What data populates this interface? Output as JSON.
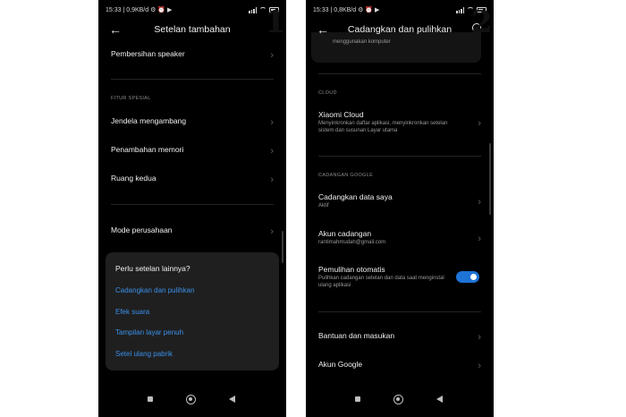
{
  "screen1": {
    "status": {
      "time_info": "15:33 | 0,9KB/d ⚙ ⏰ ▶",
      "battery": "84"
    },
    "title": "Setelan tambahan",
    "items_top": [
      {
        "label": "Pembersihan speaker"
      }
    ],
    "section_label": "FITUR SPESIAL",
    "items_special": [
      {
        "label": "Jendela mengambang"
      },
      {
        "label": "Penambahan memori"
      },
      {
        "label": "Ruang kedua"
      }
    ],
    "items_enterprise": [
      {
        "label": "Mode perusahaan"
      }
    ],
    "card": {
      "title": "Perlu setelan lainnya?",
      "links": [
        "Cadangkan dan pulihkan",
        "Efek suara",
        "Tampilan layar penuh",
        "Setel ulang pabrik"
      ]
    },
    "number_label": "1"
  },
  "screen2": {
    "status": {
      "time_info": "15:33 | 0,8KB/d ⚙ ⏰ ▶",
      "battery": "84"
    },
    "title": "Cadangkan dan pulihkan",
    "partial_text": "menggunakan komputer",
    "cloud_section": "CLOUD",
    "xiaomi_cloud": {
      "label": "Xiaomi Cloud",
      "sub": "Menyinkronkan daftar aplikasi, menyinkronkan setelan sistem dan susunan Layar utama"
    },
    "google_section": "CADANGAN GOOGLE",
    "backup_data": {
      "label": "Cadangkan data saya",
      "sub": "Aktif"
    },
    "backup_account": {
      "label": "Akun cadangan",
      "sub": "rantimahmudah@gmail.com"
    },
    "auto_restore": {
      "label": "Pemulihan otomatis",
      "sub": "Pulihkan cadangan setelan dan data saat menginstal ulang aplikasi",
      "enabled": true,
      "toggle_color": "#1e73d6"
    },
    "help": {
      "label": "Bantuan dan masukan"
    },
    "google_account": {
      "label": "Akun Google"
    },
    "number_label": "2"
  },
  "colors": {
    "link": "#3a8fe8",
    "background": "#000000",
    "card": "#1f1f1f"
  }
}
